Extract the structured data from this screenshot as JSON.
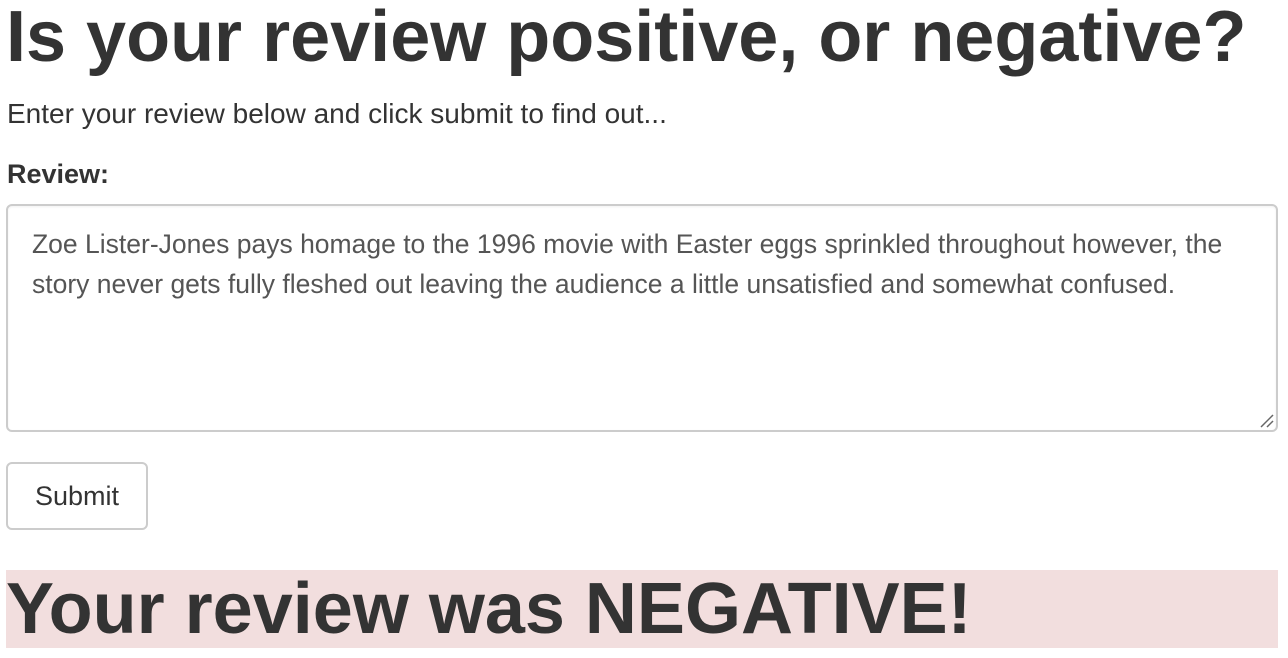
{
  "header": {
    "title": "Is your review positive, or negative?",
    "subtitle": "Enter your review below and click submit to find out..."
  },
  "form": {
    "review_label": "Review:",
    "review_value": "Zoe Lister-Jones pays homage to the 1996 movie with Easter eggs sprinkled throughout however, the story never gets fully fleshed out leaving the audience a little unsatisfied and somewhat confused.",
    "resize_icon": "resize-grip-icon",
    "submit_label": "Submit"
  },
  "result": {
    "text": "Your review was NEGATIVE!",
    "background_color": "#f2dede"
  }
}
